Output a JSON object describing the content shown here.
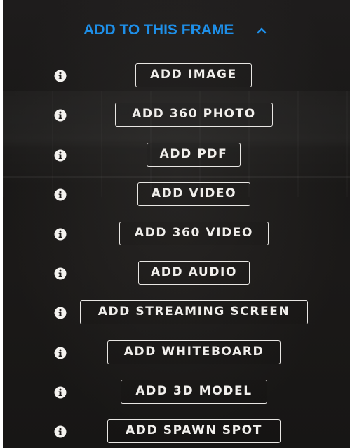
{
  "header": {
    "title": "ADD TO THIS FRAME",
    "accent_color": "#1e8fe8",
    "toggle_icon": "chevron-up-icon"
  },
  "items": [
    {
      "label": "ADD IMAGE",
      "info_icon": "info-icon"
    },
    {
      "label": "ADD 360 PHOTO",
      "info_icon": "info-icon"
    },
    {
      "label": "ADD PDF",
      "info_icon": "info-icon"
    },
    {
      "label": "ADD VIDEO",
      "info_icon": "info-icon"
    },
    {
      "label": "ADD 360 VIDEO",
      "info_icon": "info-icon"
    },
    {
      "label": "ADD AUDIO",
      "info_icon": "info-icon"
    },
    {
      "label": "ADD STREAMING SCREEN",
      "info_icon": "info-icon"
    },
    {
      "label": "ADD WHITEBOARD",
      "info_icon": "info-icon"
    },
    {
      "label": "ADD 3D MODEL",
      "info_icon": "info-icon"
    },
    {
      "label": "ADD SPAWN SPOT",
      "info_icon": "info-icon"
    }
  ]
}
